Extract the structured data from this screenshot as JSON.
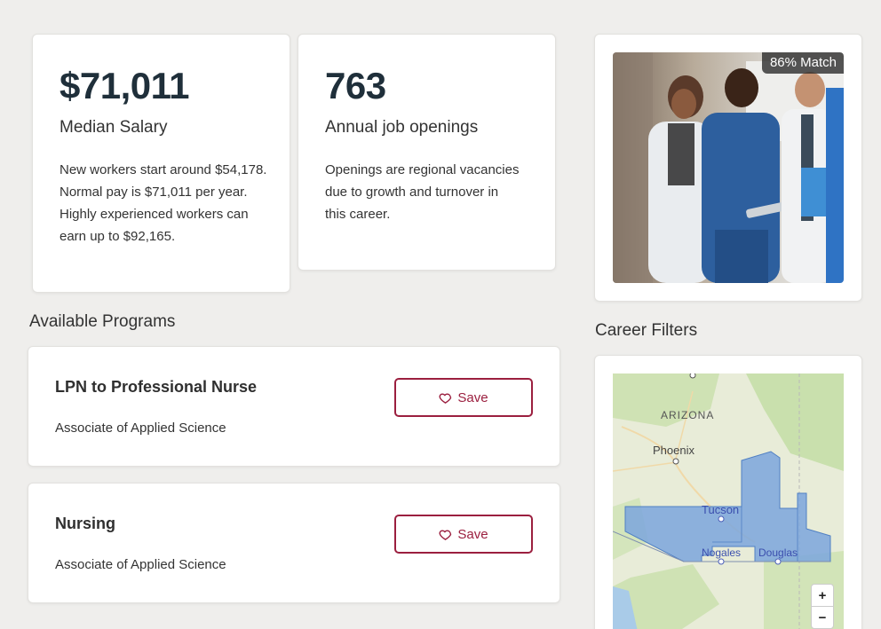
{
  "stats": [
    {
      "value": "$71,011",
      "label": "Median Salary",
      "description": "New workers start around $54,178. Normal pay is $71,011 per year. Highly experienced workers can earn up to $92,165."
    },
    {
      "value": "763",
      "label": "Annual job openings",
      "description": "Openings are regional vacancies due to growth and turnover in this career."
    }
  ],
  "match": {
    "badge": "86% Match"
  },
  "programs": {
    "title": "Available Programs",
    "items": [
      {
        "name": "LPN to Professional Nurse",
        "degree": "Associate of Applied Science",
        "save_label": "Save"
      },
      {
        "name": "Nursing",
        "degree": "Associate of Applied Science",
        "save_label": "Save"
      }
    ]
  },
  "filters": {
    "title": "Career Filters"
  },
  "map": {
    "state": "ARIZONA",
    "cities": [
      "Phoenix",
      "Tucson",
      "Nogales",
      "Douglas"
    ],
    "zoom_in": "+",
    "zoom_out": "−"
  },
  "colors": {
    "accent": "#9b1f3f",
    "region_fill": "#7ba6dd"
  }
}
